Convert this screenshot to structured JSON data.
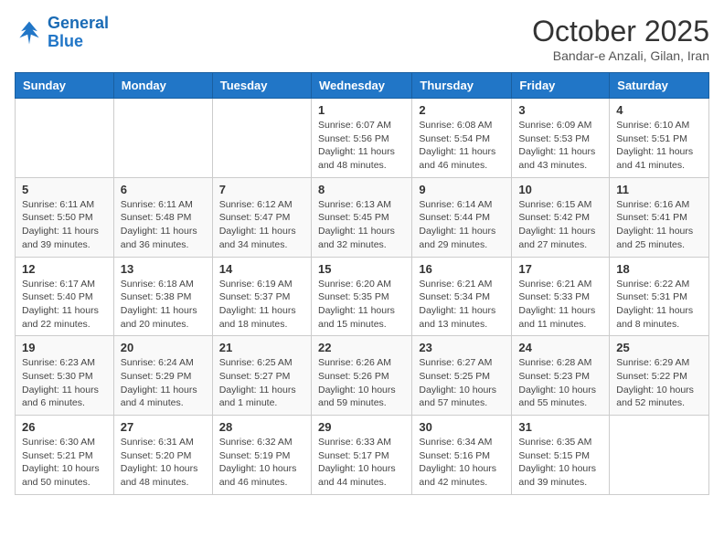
{
  "header": {
    "logo_line1": "General",
    "logo_line2": "Blue",
    "month": "October 2025",
    "location": "Bandar-e Anzali, Gilan, Iran"
  },
  "weekdays": [
    "Sunday",
    "Monday",
    "Tuesday",
    "Wednesday",
    "Thursday",
    "Friday",
    "Saturday"
  ],
  "weeks": [
    [
      {
        "day": "",
        "info": ""
      },
      {
        "day": "",
        "info": ""
      },
      {
        "day": "",
        "info": ""
      },
      {
        "day": "1",
        "info": "Sunrise: 6:07 AM\nSunset: 5:56 PM\nDaylight: 11 hours and 48 minutes."
      },
      {
        "day": "2",
        "info": "Sunrise: 6:08 AM\nSunset: 5:54 PM\nDaylight: 11 hours and 46 minutes."
      },
      {
        "day": "3",
        "info": "Sunrise: 6:09 AM\nSunset: 5:53 PM\nDaylight: 11 hours and 43 minutes."
      },
      {
        "day": "4",
        "info": "Sunrise: 6:10 AM\nSunset: 5:51 PM\nDaylight: 11 hours and 41 minutes."
      }
    ],
    [
      {
        "day": "5",
        "info": "Sunrise: 6:11 AM\nSunset: 5:50 PM\nDaylight: 11 hours and 39 minutes."
      },
      {
        "day": "6",
        "info": "Sunrise: 6:11 AM\nSunset: 5:48 PM\nDaylight: 11 hours and 36 minutes."
      },
      {
        "day": "7",
        "info": "Sunrise: 6:12 AM\nSunset: 5:47 PM\nDaylight: 11 hours and 34 minutes."
      },
      {
        "day": "8",
        "info": "Sunrise: 6:13 AM\nSunset: 5:45 PM\nDaylight: 11 hours and 32 minutes."
      },
      {
        "day": "9",
        "info": "Sunrise: 6:14 AM\nSunset: 5:44 PM\nDaylight: 11 hours and 29 minutes."
      },
      {
        "day": "10",
        "info": "Sunrise: 6:15 AM\nSunset: 5:42 PM\nDaylight: 11 hours and 27 minutes."
      },
      {
        "day": "11",
        "info": "Sunrise: 6:16 AM\nSunset: 5:41 PM\nDaylight: 11 hours and 25 minutes."
      }
    ],
    [
      {
        "day": "12",
        "info": "Sunrise: 6:17 AM\nSunset: 5:40 PM\nDaylight: 11 hours and 22 minutes."
      },
      {
        "day": "13",
        "info": "Sunrise: 6:18 AM\nSunset: 5:38 PM\nDaylight: 11 hours and 20 minutes."
      },
      {
        "day": "14",
        "info": "Sunrise: 6:19 AM\nSunset: 5:37 PM\nDaylight: 11 hours and 18 minutes."
      },
      {
        "day": "15",
        "info": "Sunrise: 6:20 AM\nSunset: 5:35 PM\nDaylight: 11 hours and 15 minutes."
      },
      {
        "day": "16",
        "info": "Sunrise: 6:21 AM\nSunset: 5:34 PM\nDaylight: 11 hours and 13 minutes."
      },
      {
        "day": "17",
        "info": "Sunrise: 6:21 AM\nSunset: 5:33 PM\nDaylight: 11 hours and 11 minutes."
      },
      {
        "day": "18",
        "info": "Sunrise: 6:22 AM\nSunset: 5:31 PM\nDaylight: 11 hours and 8 minutes."
      }
    ],
    [
      {
        "day": "19",
        "info": "Sunrise: 6:23 AM\nSunset: 5:30 PM\nDaylight: 11 hours and 6 minutes."
      },
      {
        "day": "20",
        "info": "Sunrise: 6:24 AM\nSunset: 5:29 PM\nDaylight: 11 hours and 4 minutes."
      },
      {
        "day": "21",
        "info": "Sunrise: 6:25 AM\nSunset: 5:27 PM\nDaylight: 11 hours and 1 minute."
      },
      {
        "day": "22",
        "info": "Sunrise: 6:26 AM\nSunset: 5:26 PM\nDaylight: 10 hours and 59 minutes."
      },
      {
        "day": "23",
        "info": "Sunrise: 6:27 AM\nSunset: 5:25 PM\nDaylight: 10 hours and 57 minutes."
      },
      {
        "day": "24",
        "info": "Sunrise: 6:28 AM\nSunset: 5:23 PM\nDaylight: 10 hours and 55 minutes."
      },
      {
        "day": "25",
        "info": "Sunrise: 6:29 AM\nSunset: 5:22 PM\nDaylight: 10 hours and 52 minutes."
      }
    ],
    [
      {
        "day": "26",
        "info": "Sunrise: 6:30 AM\nSunset: 5:21 PM\nDaylight: 10 hours and 50 minutes."
      },
      {
        "day": "27",
        "info": "Sunrise: 6:31 AM\nSunset: 5:20 PM\nDaylight: 10 hours and 48 minutes."
      },
      {
        "day": "28",
        "info": "Sunrise: 6:32 AM\nSunset: 5:19 PM\nDaylight: 10 hours and 46 minutes."
      },
      {
        "day": "29",
        "info": "Sunrise: 6:33 AM\nSunset: 5:17 PM\nDaylight: 10 hours and 44 minutes."
      },
      {
        "day": "30",
        "info": "Sunrise: 6:34 AM\nSunset: 5:16 PM\nDaylight: 10 hours and 42 minutes."
      },
      {
        "day": "31",
        "info": "Sunrise: 6:35 AM\nSunset: 5:15 PM\nDaylight: 10 hours and 39 minutes."
      },
      {
        "day": "",
        "info": ""
      }
    ]
  ]
}
